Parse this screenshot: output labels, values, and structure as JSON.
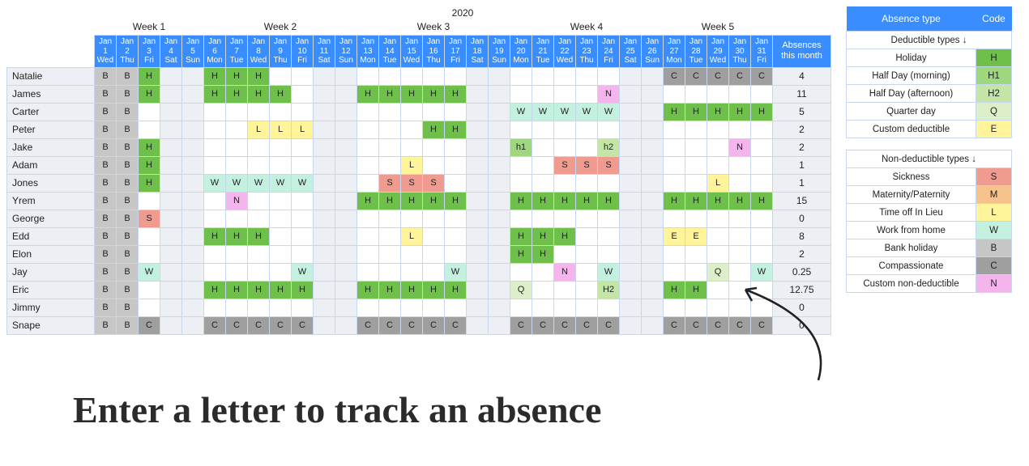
{
  "year": "2020",
  "weeks": [
    {
      "label": "Week 1",
      "span": 5
    },
    {
      "label": "Week 2",
      "span": 7
    },
    {
      "label": "Week 3",
      "span": 7
    },
    {
      "label": "Week 4",
      "span": 7
    },
    {
      "label": "Week 5",
      "span": 5
    }
  ],
  "days": [
    {
      "m": "Jan",
      "d": "1",
      "w": "Wed",
      "we": false
    },
    {
      "m": "Jan",
      "d": "2",
      "w": "Thu",
      "we": false
    },
    {
      "m": "Jan",
      "d": "3",
      "w": "Fri",
      "we": false
    },
    {
      "m": "Jan",
      "d": "4",
      "w": "Sat",
      "we": true
    },
    {
      "m": "Jan",
      "d": "5",
      "w": "Sun",
      "we": true
    },
    {
      "m": "Jan",
      "d": "6",
      "w": "Mon",
      "we": false
    },
    {
      "m": "Jan",
      "d": "7",
      "w": "Tue",
      "we": false
    },
    {
      "m": "Jan",
      "d": "8",
      "w": "Wed",
      "we": false
    },
    {
      "m": "Jan",
      "d": "9",
      "w": "Thu",
      "we": false
    },
    {
      "m": "Jan",
      "d": "10",
      "w": "Fri",
      "we": false
    },
    {
      "m": "Jan",
      "d": "11",
      "w": "Sat",
      "we": true
    },
    {
      "m": "Jan",
      "d": "12",
      "w": "Sun",
      "we": true
    },
    {
      "m": "Jan",
      "d": "13",
      "w": "Mon",
      "we": false
    },
    {
      "m": "Jan",
      "d": "14",
      "w": "Tue",
      "we": false
    },
    {
      "m": "Jan",
      "d": "15",
      "w": "Wed",
      "we": false
    },
    {
      "m": "Jan",
      "d": "16",
      "w": "Thu",
      "we": false
    },
    {
      "m": "Jan",
      "d": "17",
      "w": "Fri",
      "we": false
    },
    {
      "m": "Jan",
      "d": "18",
      "w": "Sat",
      "we": true
    },
    {
      "m": "Jan",
      "d": "19",
      "w": "Sun",
      "we": true
    },
    {
      "m": "Jan",
      "d": "20",
      "w": "Mon",
      "we": false
    },
    {
      "m": "Jan",
      "d": "21",
      "w": "Tue",
      "we": false
    },
    {
      "m": "Jan",
      "d": "22",
      "w": "Wed",
      "we": false
    },
    {
      "m": "Jan",
      "d": "23",
      "w": "Thu",
      "we": false
    },
    {
      "m": "Jan",
      "d": "24",
      "w": "Fri",
      "we": false
    },
    {
      "m": "Jan",
      "d": "25",
      "w": "Sat",
      "we": true
    },
    {
      "m": "Jan",
      "d": "26",
      "w": "Sun",
      "we": true
    },
    {
      "m": "Jan",
      "d": "27",
      "w": "Mon",
      "we": false
    },
    {
      "m": "Jan",
      "d": "28",
      "w": "Tue",
      "we": false
    },
    {
      "m": "Jan",
      "d": "29",
      "w": "Wed",
      "we": false
    },
    {
      "m": "Jan",
      "d": "30",
      "w": "Thu",
      "we": false
    },
    {
      "m": "Jan",
      "d": "31",
      "w": "Fri",
      "we": false
    }
  ],
  "absHeader": "Absences this month",
  "rows": [
    {
      "name": "Natalie",
      "abs": "4",
      "cells": [
        "B",
        "B",
        "H",
        "",
        "",
        "H",
        "H",
        "H",
        "",
        "",
        "",
        "",
        "",
        "",
        "",
        "",
        "",
        "",
        "",
        "",
        "",
        "",
        "",
        "",
        "",
        "",
        "C",
        "C",
        "C",
        "C",
        "C"
      ]
    },
    {
      "name": "James",
      "abs": "11",
      "cells": [
        "B",
        "B",
        "H",
        "",
        "",
        "H",
        "H",
        "H",
        "H",
        "",
        "",
        "",
        "H",
        "H",
        "H",
        "H",
        "H",
        "",
        "",
        "",
        "",
        "",
        "",
        "N",
        "",
        "",
        "",
        "",
        "",
        "",
        ""
      ]
    },
    {
      "name": "Carter",
      "abs": "5",
      "cells": [
        "B",
        "B",
        "",
        "",
        "",
        "",
        "",
        "",
        "",
        "",
        "",
        "",
        "",
        "",
        "",
        "",
        "",
        "",
        "",
        "W",
        "W",
        "W",
        "W",
        "W",
        "",
        "",
        "H",
        "H",
        "H",
        "H",
        "H"
      ]
    },
    {
      "name": "Peter",
      "abs": "2",
      "cells": [
        "B",
        "B",
        "",
        "",
        "",
        "",
        "",
        "L",
        "L",
        "L",
        "",
        "",
        "",
        "",
        "",
        "H",
        "H",
        "",
        "",
        "",
        "",
        "",
        "",
        "",
        "",
        "",
        "",
        "",
        "",
        "",
        ""
      ]
    },
    {
      "name": "Jake",
      "abs": "2",
      "cells": [
        "B",
        "B",
        "H",
        "",
        "",
        "",
        "",
        "",
        "",
        "",
        "",
        "",
        "",
        "",
        "",
        "",
        "",
        "",
        "",
        "h1",
        "",
        "",
        "",
        "h2",
        "",
        "",
        "",
        "",
        "",
        "N",
        ""
      ]
    },
    {
      "name": "Adam",
      "abs": "1",
      "cells": [
        "B",
        "B",
        "H",
        "",
        "",
        "",
        "",
        "",
        "",
        "",
        "",
        "",
        "",
        "",
        "L",
        "",
        "",
        "",
        "",
        "",
        "",
        "S",
        "S",
        "S",
        "",
        "",
        "",
        "",
        "",
        "",
        ""
      ]
    },
    {
      "name": "Jones",
      "abs": "1",
      "cells": [
        "B",
        "B",
        "H",
        "",
        "",
        "W",
        "W",
        "W",
        "W",
        "W",
        "",
        "",
        "",
        "S",
        "S",
        "S",
        "",
        "",
        "",
        "",
        "",
        "",
        "",
        "",
        "",
        "",
        "",
        "",
        "L",
        "",
        ""
      ]
    },
    {
      "name": "Yrem",
      "abs": "15",
      "cells": [
        "B",
        "B",
        "",
        "",
        "",
        "",
        "N",
        "",
        "",
        "",
        "",
        "",
        "H",
        "H",
        "H",
        "H",
        "H",
        "",
        "",
        "H",
        "H",
        "H",
        "H",
        "H",
        "",
        "",
        "H",
        "H",
        "H",
        "H",
        "H"
      ]
    },
    {
      "name": "George",
      "abs": "0",
      "cells": [
        "B",
        "B",
        "S",
        "",
        "",
        "",
        "",
        "",
        "",
        "",
        "",
        "",
        "",
        "",
        "",
        "",
        "",
        "",
        "",
        "",
        "",
        "",
        "",
        "",
        "",
        "",
        "",
        "",
        "",
        "",
        ""
      ]
    },
    {
      "name": "Edd",
      "abs": "8",
      "cells": [
        "B",
        "B",
        "",
        "",
        "",
        "H",
        "H",
        "H",
        "",
        "",
        "",
        "",
        "",
        "",
        "L",
        "",
        "",
        "",
        "",
        "H",
        "H",
        "H",
        "",
        "",
        "",
        "",
        "E",
        "E",
        "",
        "",
        ""
      ]
    },
    {
      "name": "Elon",
      "abs": "2",
      "cells": [
        "B",
        "B",
        "",
        "",
        "",
        "",
        "",
        "",
        "",
        "",
        "",
        "",
        "",
        "",
        "",
        "",
        "",
        "",
        "",
        "H",
        "H",
        "",
        "",
        "",
        "",
        "",
        "",
        "",
        "",
        "",
        ""
      ]
    },
    {
      "name": "Jay",
      "abs": "0.25",
      "cells": [
        "B",
        "B",
        "W",
        "",
        "",
        "",
        "",
        "",
        "",
        "W",
        "",
        "",
        "",
        "",
        "",
        "",
        "W",
        "",
        "",
        "",
        "",
        "N",
        "",
        "W",
        "",
        "",
        "",
        "",
        "Q",
        "",
        "W"
      ]
    },
    {
      "name": "Eric",
      "abs": "12.75",
      "cells": [
        "B",
        "B",
        "",
        "",
        "",
        "H",
        "H",
        "H",
        "H",
        "H",
        "",
        "",
        "H",
        "H",
        "H",
        "H",
        "H",
        "",
        "",
        "Q",
        "",
        "",
        "",
        "H2",
        "",
        "",
        "H",
        "H",
        "",
        "",
        ""
      ]
    },
    {
      "name": "Jimmy",
      "abs": "0",
      "cells": [
        "B",
        "B",
        "",
        "",
        "",
        "",
        "",
        "",
        "",
        "",
        "",
        "",
        "",
        "",
        "",
        "",
        "",
        "",
        "",
        "",
        "",
        "",
        "",
        "",
        "",
        "",
        "",
        "",
        "",
        "",
        ""
      ]
    },
    {
      "name": "Snape",
      "abs": "0",
      "cells": [
        "B",
        "B",
        "C",
        "",
        "",
        "C",
        "C",
        "C",
        "C",
        "C",
        "",
        "",
        "C",
        "C",
        "C",
        "C",
        "C",
        "",
        "",
        "C",
        "C",
        "C",
        "C",
        "C",
        "",
        "",
        "C",
        "C",
        "C",
        "C",
        "C"
      ]
    }
  ],
  "legend": {
    "header_type": "Absence type",
    "header_code": "Code",
    "ded_title": "Deductible types ↓",
    "non_title": "Non-deductible types ↓",
    "ded": [
      {
        "label": "Holiday",
        "code": "H"
      },
      {
        "label": "Half Day (morning)",
        "code": "H1"
      },
      {
        "label": "Half Day (afternoon)",
        "code": "H2"
      },
      {
        "label": "Quarter day",
        "code": "Q"
      },
      {
        "label": "Custom deductible",
        "code": "E"
      }
    ],
    "non": [
      {
        "label": "Sickness",
        "code": "S"
      },
      {
        "label": "Maternity/Paternity",
        "code": "M"
      },
      {
        "label": "Time off In Lieu",
        "code": "L"
      },
      {
        "label": "Work from home",
        "code": "W"
      },
      {
        "label": "Bank holiday",
        "code": "B"
      },
      {
        "label": "Compassionate",
        "code": "C"
      },
      {
        "label": "Custom non-deductible",
        "code": "N"
      }
    ]
  },
  "caption": "Enter a letter to track an absence"
}
